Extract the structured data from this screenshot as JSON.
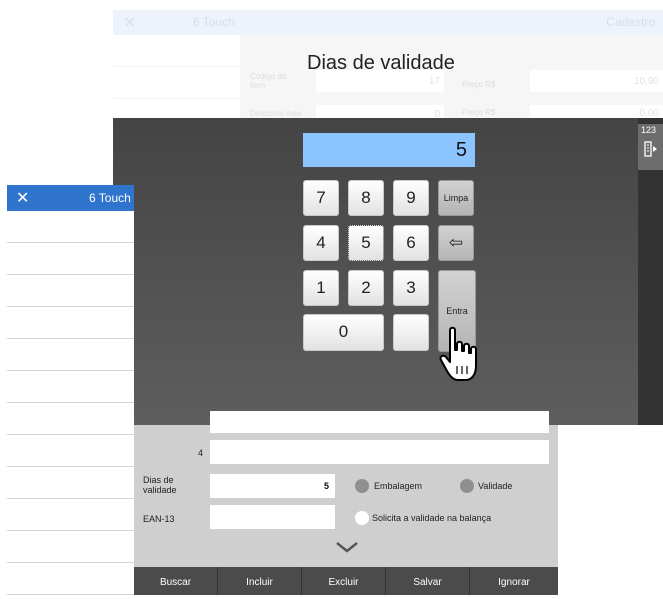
{
  "back_window": {
    "title": "6 Touch",
    "right_title": "Cadastro",
    "close_glyph": "✕",
    "fields": [
      {
        "label": "Código do item",
        "value": "17",
        "right_label": "Preço R$",
        "right_value": "10,90"
      },
      {
        "label": "Desconto máx",
        "value": "0",
        "right_label": "Preço R$",
        "right_value": "0,00"
      }
    ]
  },
  "dialog": {
    "title": "Dias de validade",
    "display_value": "5",
    "keys": {
      "k7": "7",
      "k8": "8",
      "k9": "9",
      "k4": "4",
      "k5": "5",
      "k6": "6",
      "k1": "1",
      "k2": "2",
      "k3": "3",
      "k0": "0",
      "clear": "Limpa",
      "backspace": "⇦",
      "enter": "Entra"
    },
    "side_tab_label": "123",
    "icons": {
      "side_tab": "keyboard-exit-icon",
      "cursor": "hand-pointer-icon",
      "backspace": "backspace-arrow-icon"
    }
  },
  "left_window": {
    "title": "6 Touch",
    "close_glyph": "✕",
    "rows": 12
  },
  "form": {
    "row4_label": "4",
    "dias_label_1": "Dias de",
    "dias_label_2": "validade",
    "dias_value": "5",
    "ean_label": "EAN-13",
    "radio_embalagem": "Embalagem",
    "radio_validade": "Validade",
    "radio_solicita": "Solicita a validade na balança",
    "expand_icon": "chevron-down-icon"
  },
  "toolbar": {
    "buscar": "Buscar",
    "incluir": "Incluir",
    "excluir": "Excluir",
    "salvar": "Salvar",
    "ignorar": "Ignorar"
  },
  "colors": {
    "accent_blue": "#2f74cd",
    "display_blue": "#8cc4ff",
    "overlay_dark": "#4a4a4a",
    "toolbar": "#4b4b4b"
  }
}
